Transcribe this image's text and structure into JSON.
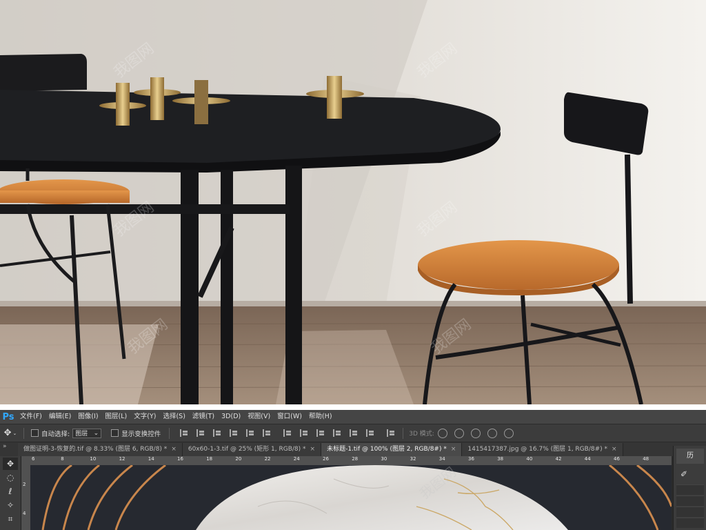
{
  "photo": {
    "description_alt": "",
    "colors": {
      "wall": "#e6e3de",
      "floor": "#8a7563",
      "table": "#1f1f22",
      "seat": "#d98a3e",
      "metal": "#1c1c1e",
      "brass": "#c9a35b"
    }
  },
  "watermark": {
    "text": "我图网"
  },
  "photoshop": {
    "logo": "Ps",
    "menu": [
      "文件(F)",
      "编辑(E)",
      "图像(I)",
      "图层(L)",
      "文字(Y)",
      "选择(S)",
      "滤镜(T)",
      "3D(D)",
      "视图(V)",
      "窗口(W)",
      "帮助(H)"
    ],
    "options": {
      "auto_select_label": "自动选择:",
      "auto_select_value": "图层",
      "show_transform_label": "显示变换控件",
      "mode_3d_label": "3D 模式:"
    },
    "tabs": [
      {
        "label": "做图证明-3-恢复的.tif @ 8.33% (图层 6, RGB/8) *",
        "active": false
      },
      {
        "label": "60x60-1-3.tif @ 25% (矩形 1, RGB/8) *",
        "active": false
      },
      {
        "label": "未标题-1.tif @ 100% (图层 2, RGB/8#) *",
        "active": true
      },
      {
        "label": "1415417387.jpg @ 16.7% (图层 1, RGB/8#) *",
        "active": false
      }
    ],
    "tabs_arrow": "»",
    "ruler_h": [
      "6",
      "8",
      "10",
      "12",
      "14",
      "16",
      "18",
      "20",
      "22",
      "24",
      "26",
      "28",
      "30",
      "32",
      "34",
      "36",
      "38",
      "40",
      "42",
      "44",
      "46",
      "48",
      "50"
    ],
    "ruler_v": [
      "2",
      "4"
    ],
    "panel": {
      "tab_label": "历"
    },
    "colors": {
      "menubar": "#454545",
      "options": "#3c3c3c",
      "canvas_bg": "#262930",
      "gold": "#c8864c"
    }
  }
}
